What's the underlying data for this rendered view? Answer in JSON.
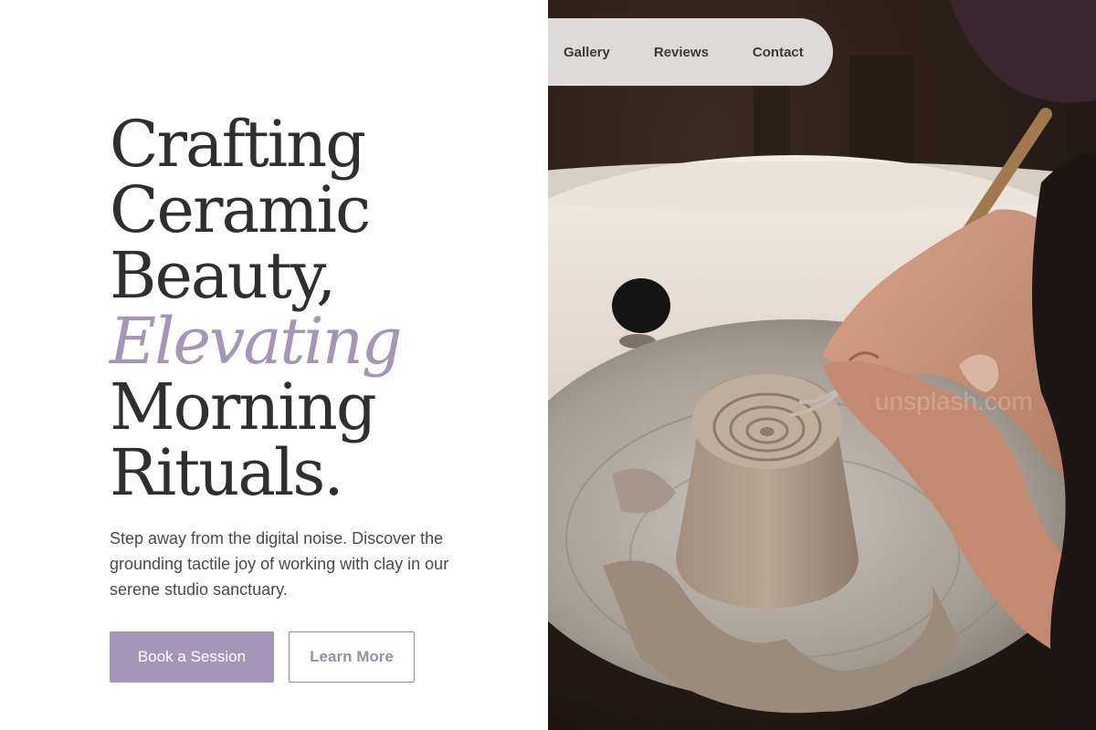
{
  "nav": {
    "items": [
      "Gallery",
      "Reviews",
      "Contact"
    ]
  },
  "hero": {
    "headline": [
      "Crafting",
      "Ceramic",
      "Beauty,",
      "Elevating",
      "Morning",
      "Rituals."
    ],
    "description": "Step away from the digital noise. Discover the grounding tactile joy of working with clay in our serene studio sanctuary.",
    "primary_cta": "Book a Session",
    "secondary_cta": "Learn More"
  },
  "photo": {
    "watermark": "unsplash.com"
  },
  "colors": {
    "accent": "#a596b9",
    "heading": "#2f2f2f",
    "body_text": "#4a4a4a",
    "nav_background": "#e8e6e6"
  }
}
